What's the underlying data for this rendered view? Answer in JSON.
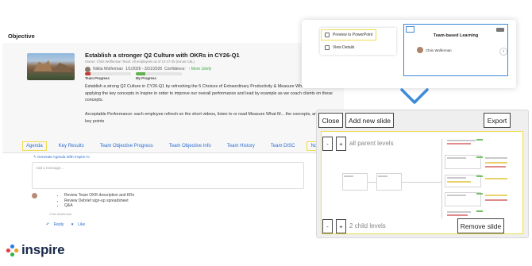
{
  "objective": {
    "section_label": "Objective",
    "title": "Establish a stronger Q2 Culture with OKRs in CY26-Q1",
    "owner_line": "Owner: Chris Wolferman  Team: All employees as of 12-17-25 (minus C&L)",
    "person": "Nikita Wolferman",
    "date_range": "1/1/2026 - 3/31/2026",
    "confidence_label": "Confidence:",
    "confidence_value": "More Likely",
    "team_progress_label": "Team Progress",
    "team_progress_percent": 12,
    "my_progress_label": "My Progress",
    "my_progress_percent": 20,
    "description": "Establish a strong Q2 Culture in CY26-Q1 by refreshing the 5 Choices of Extraordinary Productivity & Measure What Matters and applying the key concepts in Inspire in order to improve our overall performance and lead by example as we coach clients on these concepts.",
    "acceptable_performance": "Acceptable Performance: each employee refresh on the short videos, listen to or read Measure What M... the concepts, and debrief key points"
  },
  "tabs": [
    {
      "label": "Agenda",
      "highlighted": true
    },
    {
      "label": "Key Results",
      "highlighted": false
    },
    {
      "label": "Team Objective Progress",
      "highlighted": false
    },
    {
      "label": "Team Objective Info",
      "highlighted": false
    },
    {
      "label": "Team History",
      "highlighted": false
    },
    {
      "label": "Team DISC",
      "highlighted": false
    },
    {
      "label": "Notes",
      "highlighted": true
    }
  ],
  "agenda": {
    "generate_label": "Generate Agenda With Inspire AI",
    "message_placeholder": "Add a message...",
    "bullets": [
      "Review Team OKR description and KRs",
      "Review Debrief sign-up spreadsheet",
      "Q&A"
    ],
    "author": "Chris Wolferman",
    "reply_label": "Reply",
    "like_label": "Like"
  },
  "logo": {
    "text": "inspire",
    "mark_colors": [
      "#2b7de9",
      "#f39a1f",
      "#35b34a",
      "#e43b3b"
    ]
  },
  "popup": {
    "menu_items": [
      {
        "label": "Preview to PowerPoint",
        "icon": "powerpoint-icon",
        "highlighted": true
      },
      {
        "label": "View Details",
        "icon": "details-icon",
        "highlighted": false
      }
    ],
    "card_title": "Team-based Learning",
    "card_person": "Chris Wolferman"
  },
  "editor": {
    "close_label": "Close",
    "add_slide_label": "Add new slide",
    "export_label": "Export",
    "remove_slide_label": "Remove slide",
    "minus_label": "-",
    "plus_label": "+",
    "parent_levels_text": "all parent levels",
    "child_levels_text": "2 child levels"
  },
  "colors": {
    "accent_blue": "#2f6fcf",
    "highlight_yellow": "#f0dc4f",
    "card_border": "#3c8ad8"
  }
}
